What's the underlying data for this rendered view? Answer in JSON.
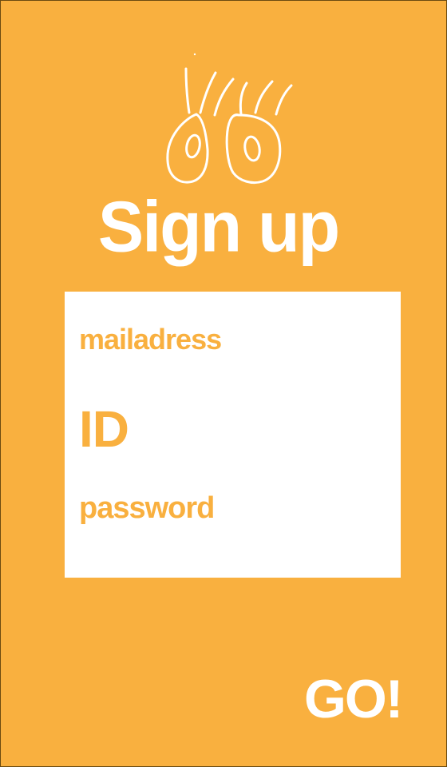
{
  "header": {
    "logo_icon": "googly-eyes-logo-icon",
    "title": "Sign up"
  },
  "form": {
    "fields": [
      {
        "name": "mail",
        "label": "mailadress"
      },
      {
        "name": "id",
        "label": "ID"
      },
      {
        "name": "password",
        "label": "password"
      }
    ]
  },
  "actions": {
    "go_label": "GO!"
  },
  "colors": {
    "background": "#f9b03f",
    "card": "#ffffff",
    "accent_text": "#f9b03f",
    "inverse_text": "#ffffff"
  }
}
